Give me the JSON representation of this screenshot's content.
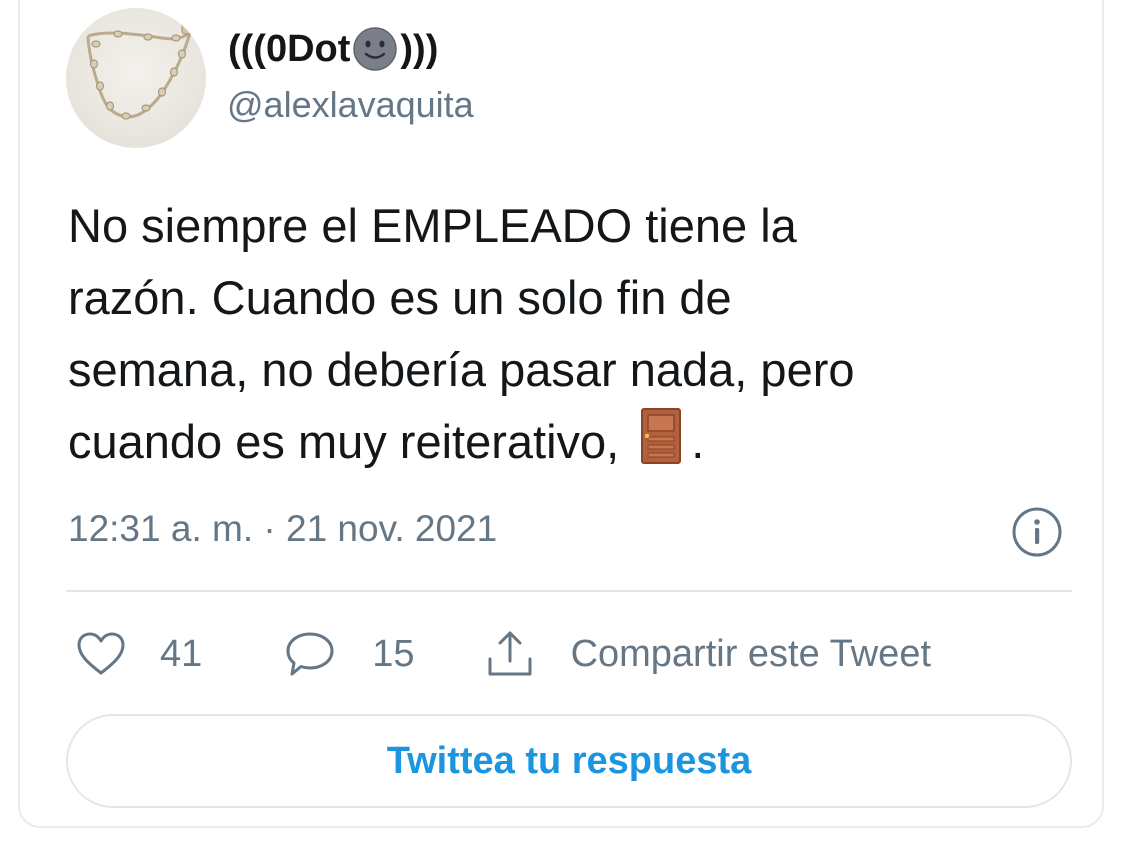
{
  "tweet": {
    "author": {
      "name_prefix": "(((0Dot",
      "name_suffix": ")))",
      "handle": "@alexlavaquita",
      "avatar_icon": "necklace-avatar"
    },
    "text_lines": [
      "No siempre el EMPLEADO tiene la",
      "razón. Cuando es un solo fin de",
      "semana, no debería pasar nada, pero",
      "cuando es muy reiterativo,"
    ],
    "text_end": ".",
    "inline_emoji": "door-icon",
    "timestamp": "12:31 a. m. · 21 nov. 2021"
  },
  "actions": {
    "like_count": "41",
    "reply_count": "15",
    "share_label": "Compartir este Tweet"
  },
  "reply_button": {
    "label": "Twittea tu respuesta"
  },
  "colors": {
    "text": "#14171a",
    "muted": "#657786",
    "accent": "#1b95e0",
    "border": "#e1e8ed"
  }
}
